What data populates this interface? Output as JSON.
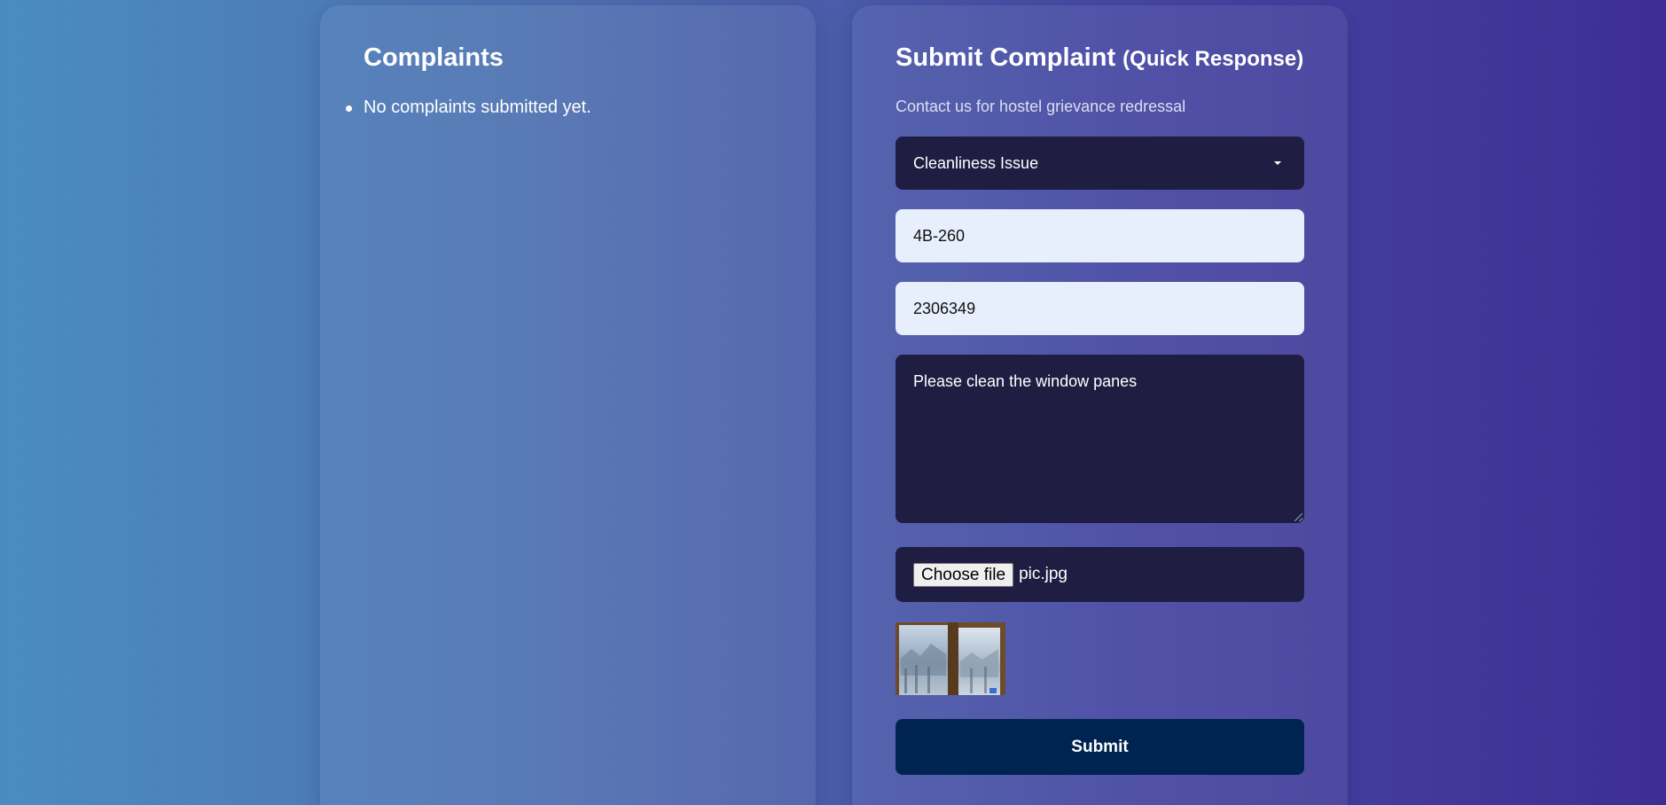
{
  "complaints_panel": {
    "title": "Complaints",
    "items": [
      "No complaints submitted yet."
    ]
  },
  "form": {
    "title": "Submit Complaint",
    "title_suffix": "(Quick Response)",
    "subtitle": "Contact us for hostel grievance redressal",
    "category": {
      "selected": "Cleanliness Issue"
    },
    "room_number": {
      "value": "4B-260"
    },
    "student_id": {
      "value": "2306349"
    },
    "description": {
      "value": "Please clean the window panes"
    },
    "file": {
      "button_label": "Choose file",
      "file_name": "pic.jpg"
    },
    "submit_label": "Submit"
  },
  "colors": {
    "background_left": "#4a8cc0",
    "background_right": "#3e2d94",
    "dark_field": "#1f1e42",
    "light_field": "#e7effd",
    "submit_button": "#002451"
  },
  "icons": {
    "select_caret": "chevron-down-icon",
    "list_bullet": "bullet-icon"
  }
}
